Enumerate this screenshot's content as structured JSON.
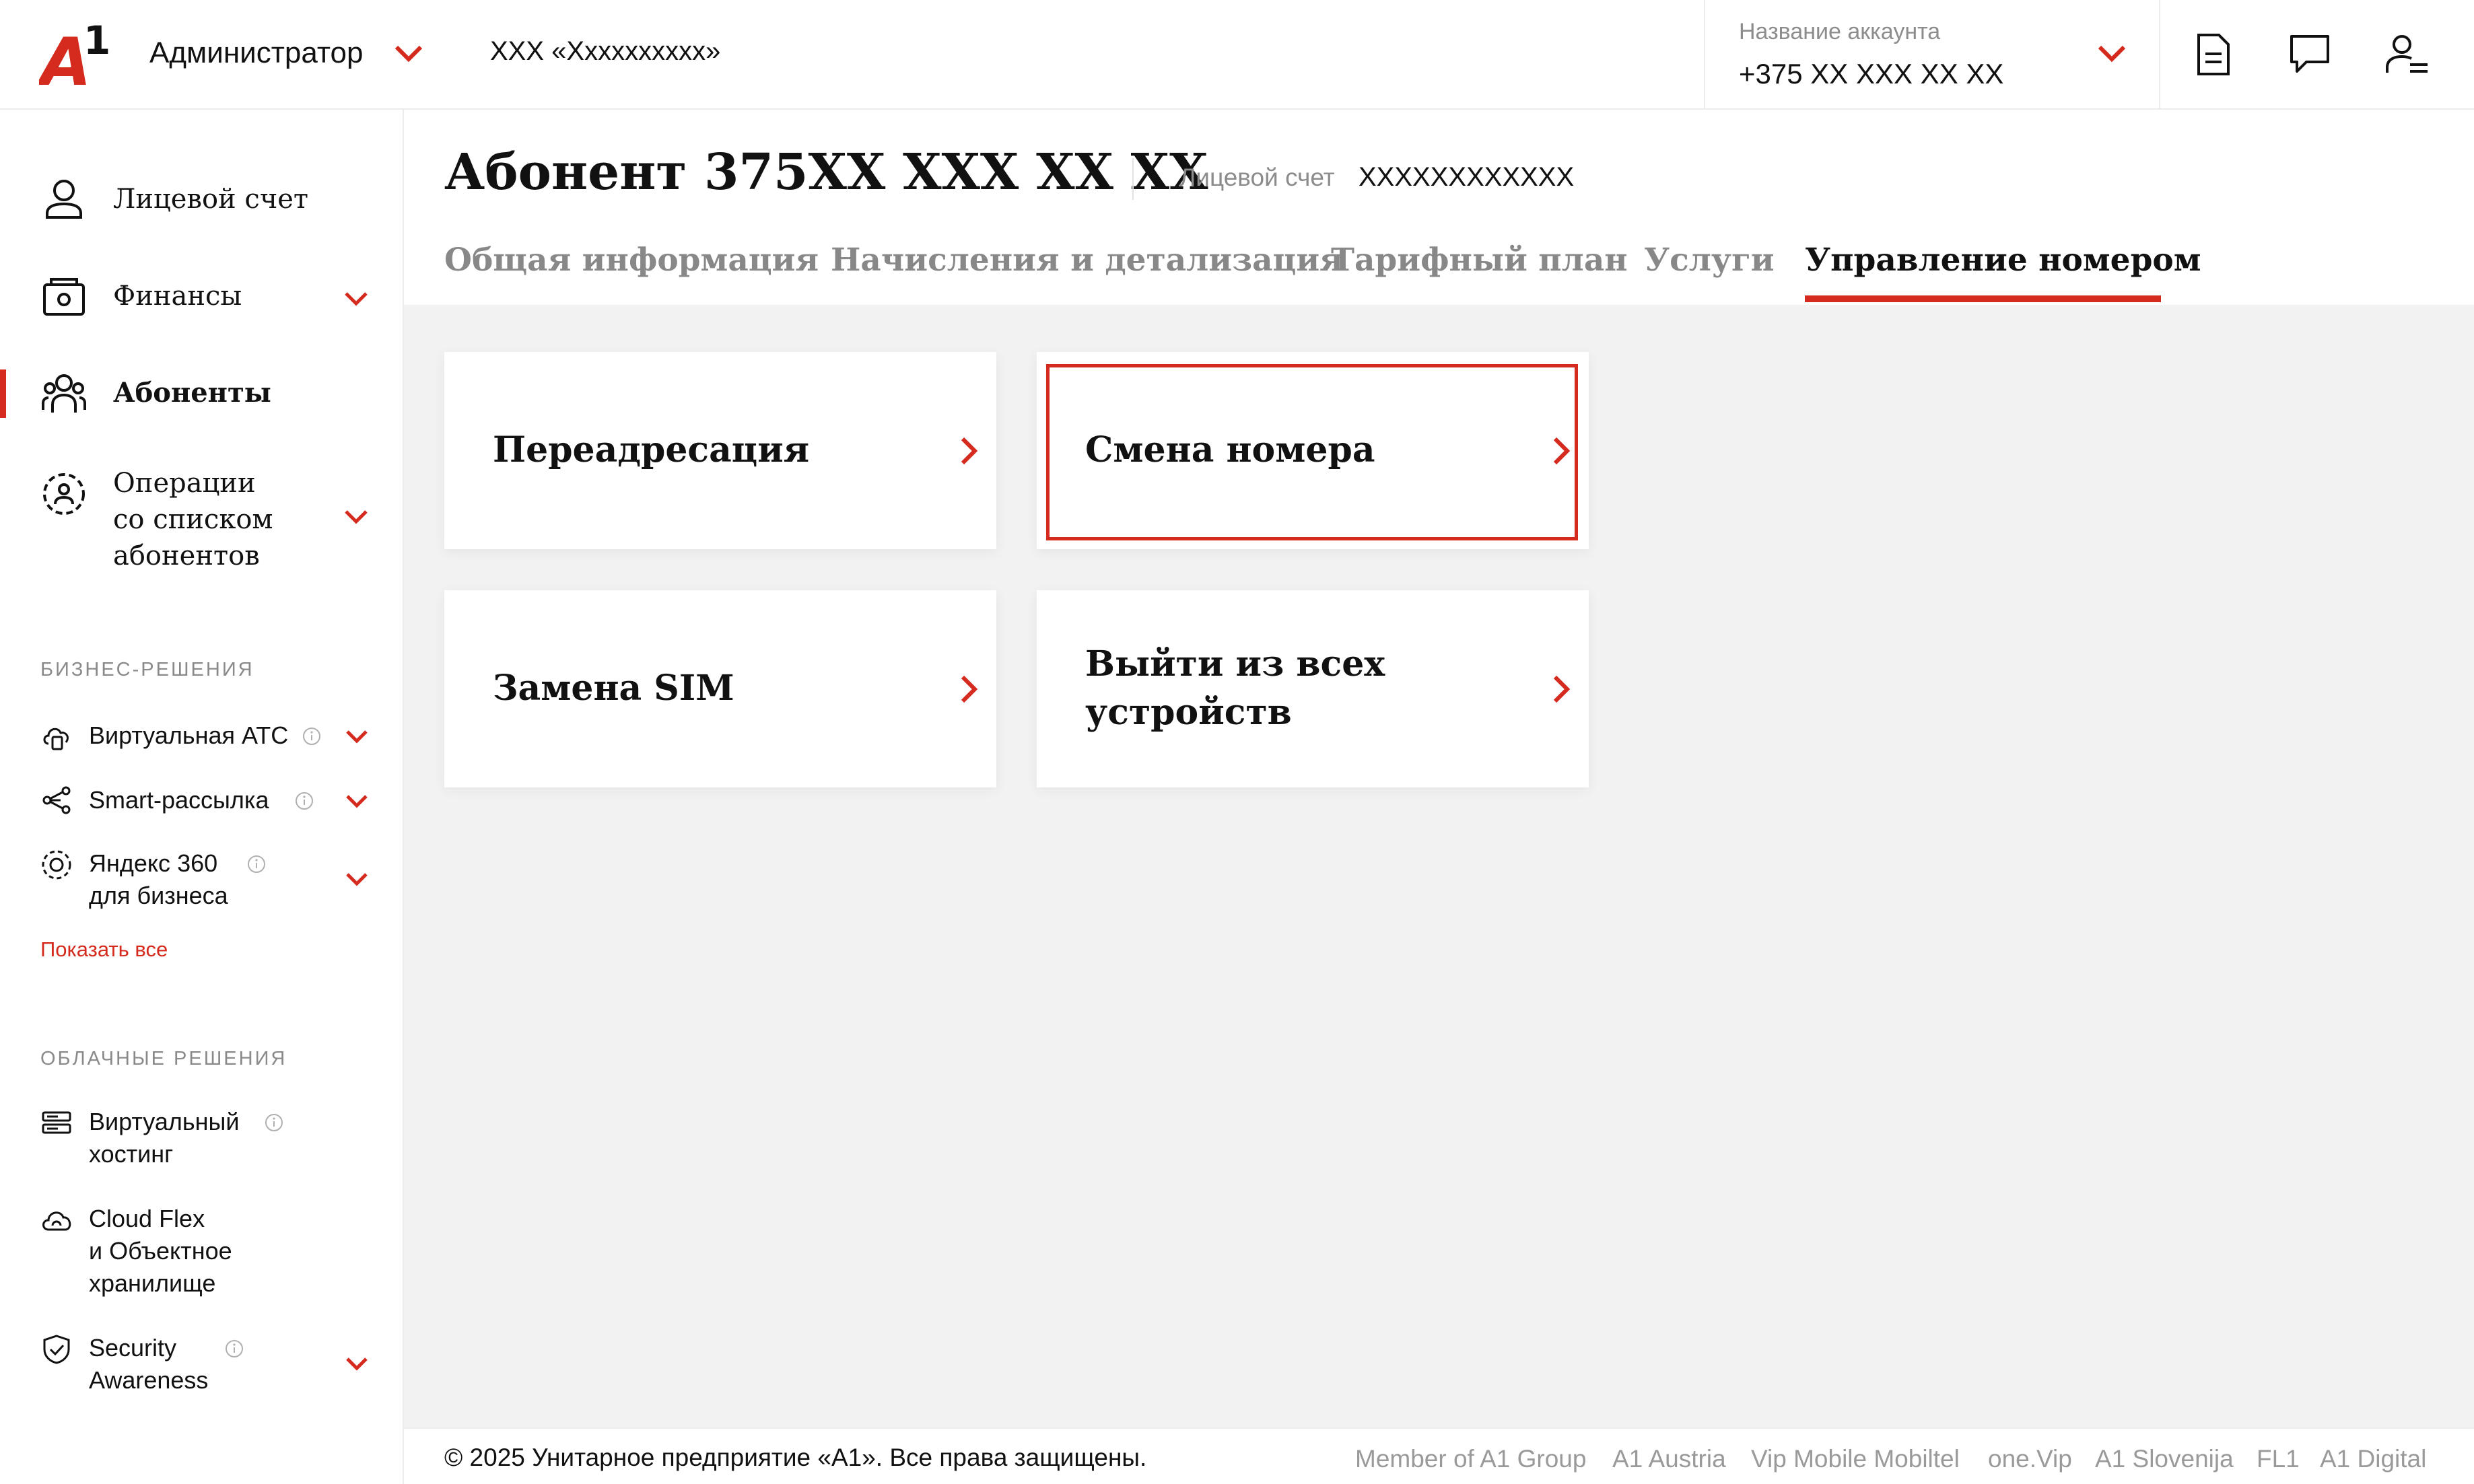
{
  "header": {
    "logo_text": "A1",
    "role": "Администратор",
    "company": "ХХХ «Хххххххххх»",
    "account_label": "Название аккаунта",
    "account_phone": "+375 ХХ ХХХ ХХ ХХ",
    "icons": [
      "document-icon",
      "chat-icon",
      "user-settings-icon"
    ]
  },
  "sidebar": {
    "items": [
      {
        "label": "Лицевой счет",
        "icon": "user-icon",
        "active": false
      },
      {
        "label": "Финансы",
        "icon": "wallet-icon",
        "active": false,
        "expandable": true
      },
      {
        "label": "Абоненты",
        "icon": "subscribers-icon",
        "active": true
      },
      {
        "label_lines": [
          "Операции",
          "со списком",
          "абонентов"
        ],
        "icon": "bulk-operations-icon",
        "expandable": true
      }
    ],
    "business": {
      "title": "БИЗНЕС-РЕШЕНИЯ",
      "items": [
        {
          "label": "Виртуальная АТС",
          "icon": "cloud-phone-icon"
        },
        {
          "label": "Smart-рассылка",
          "icon": "share-icon"
        },
        {
          "label_lines": [
            "Яндекс 360",
            "для бизнеса"
          ],
          "icon": "yandex-360-icon"
        }
      ],
      "show_all": "Показать все"
    },
    "cloud": {
      "title": "ОБЛАЧНЫЕ РЕШЕНИЯ",
      "items": [
        {
          "label_lines": [
            "Виртуальный",
            "хостинг"
          ],
          "icon": "server-icon"
        },
        {
          "label_lines": [
            "Cloud Flex",
            "и Объектное",
            "хранилище"
          ],
          "icon": "cloud-icon"
        },
        {
          "label_lines": [
            "Security",
            "Awareness"
          ],
          "icon": "shield-icon"
        }
      ]
    }
  },
  "main": {
    "title": "Абонент 375ХХ ХХХ ХХ ХХ",
    "account_label": "Лицевой счет",
    "account_value": "ХХХХХХХХХХХХ",
    "tabs": [
      {
        "label": "Общая информация",
        "active": false
      },
      {
        "label": "Начисления и детализация",
        "active": false
      },
      {
        "label": "Тарифный план",
        "active": false
      },
      {
        "label": "Услуги",
        "active": false
      },
      {
        "label": "Управление номером",
        "active": true
      }
    ],
    "cards": [
      {
        "lines": [
          "Переадресация"
        ]
      },
      {
        "lines": [
          "Смена номера"
        ],
        "focused": true
      },
      {
        "lines": [
          "Замена SIM"
        ]
      },
      {
        "lines": [
          "Выйти из всех",
          "устройств"
        ]
      }
    ]
  },
  "footer": {
    "copyright": "© 2025 Унитарное предприятие «А1». Все права защищены.",
    "links": [
      "Member of A1 Group",
      "A1 Austria",
      "Vip Mobile Mobiltel",
      "one.Vip",
      "A1 Slovenija",
      "FL1",
      "A1 Digital"
    ]
  },
  "colors": {
    "accent": "#d52b1e",
    "muted": "#8c8c8c",
    "background": "#f2f2f2"
  }
}
